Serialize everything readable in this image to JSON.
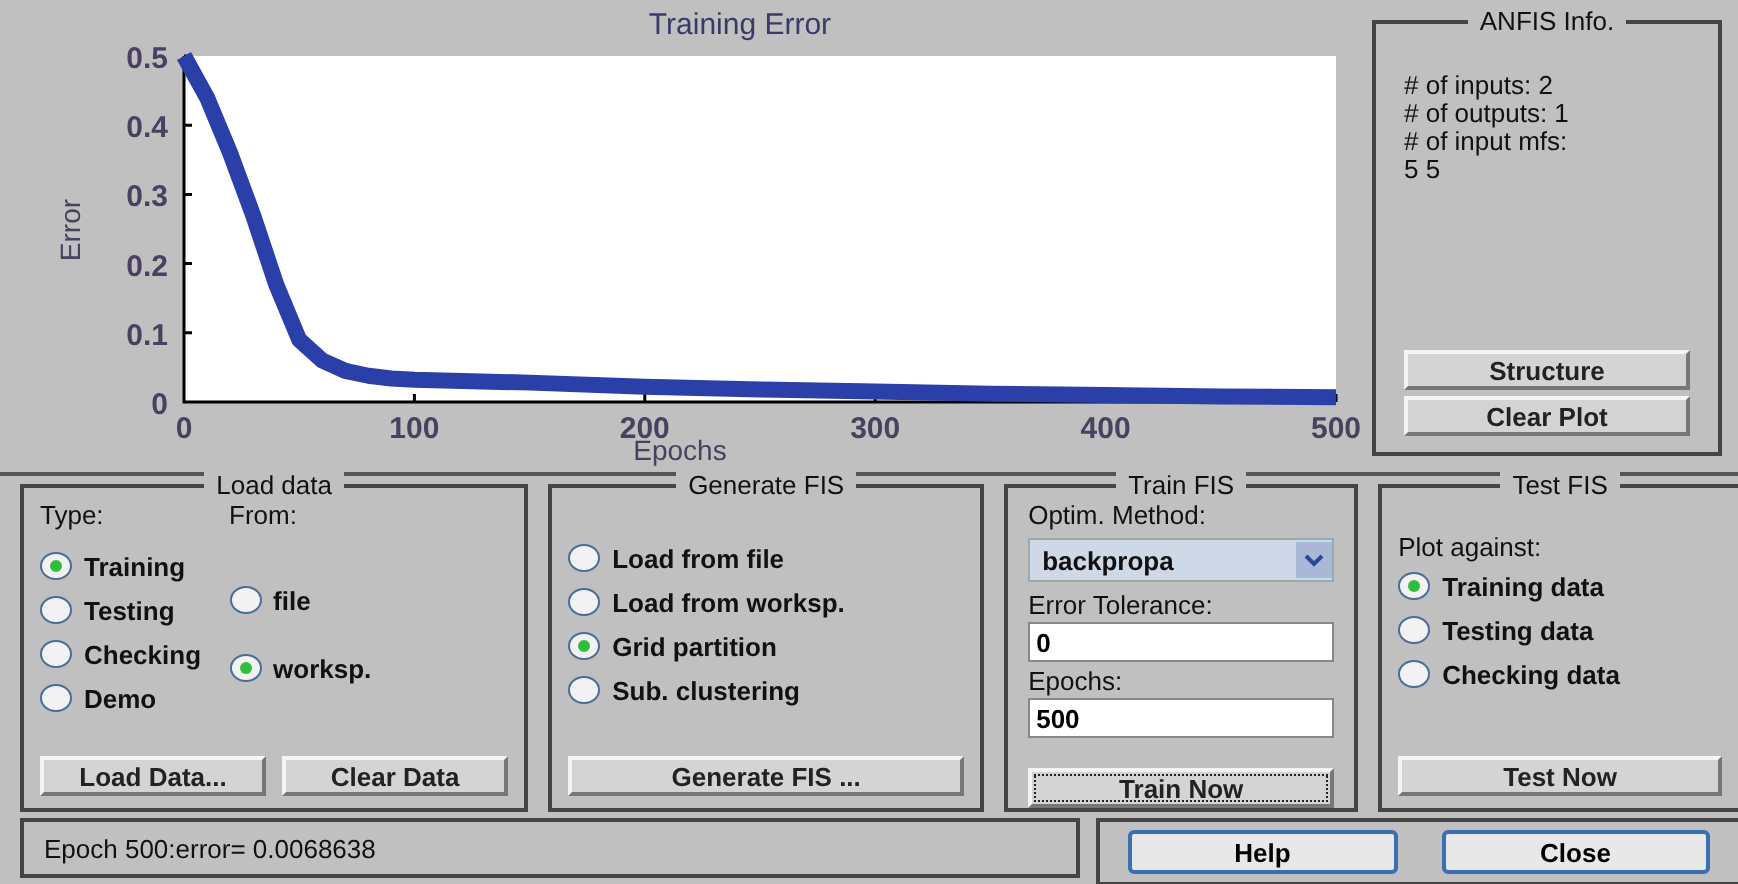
{
  "chart": {
    "chart_data": {
      "type": "line",
      "title": "Training Error",
      "xlabel": "Epochs",
      "ylabel": "Error",
      "x": [
        0,
        10,
        20,
        30,
        40,
        50,
        60,
        70,
        80,
        90,
        100,
        150,
        200,
        250,
        300,
        350,
        400,
        450,
        500
      ],
      "series": [
        {
          "color": "#2b3fa8",
          "values": [
            0.5,
            0.44,
            0.36,
            0.27,
            0.17,
            0.09,
            0.06,
            0.045,
            0.038,
            0.034,
            0.032,
            0.028,
            0.022,
            0.018,
            0.015,
            0.012,
            0.01,
            0.008,
            0.007
          ]
        }
      ],
      "xlim": [
        0,
        500
      ],
      "ylim": [
        0,
        0.5
      ],
      "xticks": [
        0,
        100,
        200,
        300,
        400,
        500
      ],
      "yticks": [
        0,
        0.1,
        0.2,
        0.3,
        0.4,
        0.5
      ]
    }
  },
  "anfis_info": {
    "title": "ANFIS Info.",
    "lines": [
      "# of inputs: 2",
      "# of outputs: 1",
      "# of input mfs:",
      "5  5"
    ],
    "buttons": [
      "Structure",
      "Clear Plot"
    ]
  },
  "load_data": {
    "title": "Load data",
    "type_label": "Type:",
    "from_label": "From:",
    "type_options": [
      {
        "label": "Training",
        "selected": true
      },
      {
        "label": "Testing",
        "selected": false
      },
      {
        "label": "Checking",
        "selected": false
      },
      {
        "label": "Demo",
        "selected": false
      }
    ],
    "from_options": [
      {
        "label": "file",
        "selected": false
      },
      {
        "label": "worksp.",
        "selected": true
      }
    ],
    "buttons": [
      "Load Data...",
      "Clear Data"
    ]
  },
  "generate_fis": {
    "title": "Generate FIS",
    "options": [
      {
        "label": "Load from file",
        "selected": false
      },
      {
        "label": "Load from worksp.",
        "selected": false
      },
      {
        "label": "Grid partition",
        "selected": true
      },
      {
        "label": "Sub. clustering",
        "selected": false
      }
    ],
    "button": "Generate FIS ..."
  },
  "train_fis": {
    "title": "Train FIS",
    "method_label": "Optim. Method:",
    "method": "backpropa",
    "tolerance_label": "Error Tolerance:",
    "tolerance": "0",
    "epochs_label": "Epochs:",
    "epochs": "500",
    "button": {
      "label": "Train Now",
      "focused": true
    }
  },
  "test_fis": {
    "title": "Test FIS",
    "plot_label": "Plot against:",
    "options": [
      {
        "label": "Training data",
        "selected": true
      },
      {
        "label": "Testing data",
        "selected": false
      },
      {
        "label": "Checking data",
        "selected": false
      }
    ],
    "button": "Test Now"
  },
  "status_bar": "Epoch 500:error= 0.0068638",
  "buttons": [
    "Help",
    "Close"
  ]
}
